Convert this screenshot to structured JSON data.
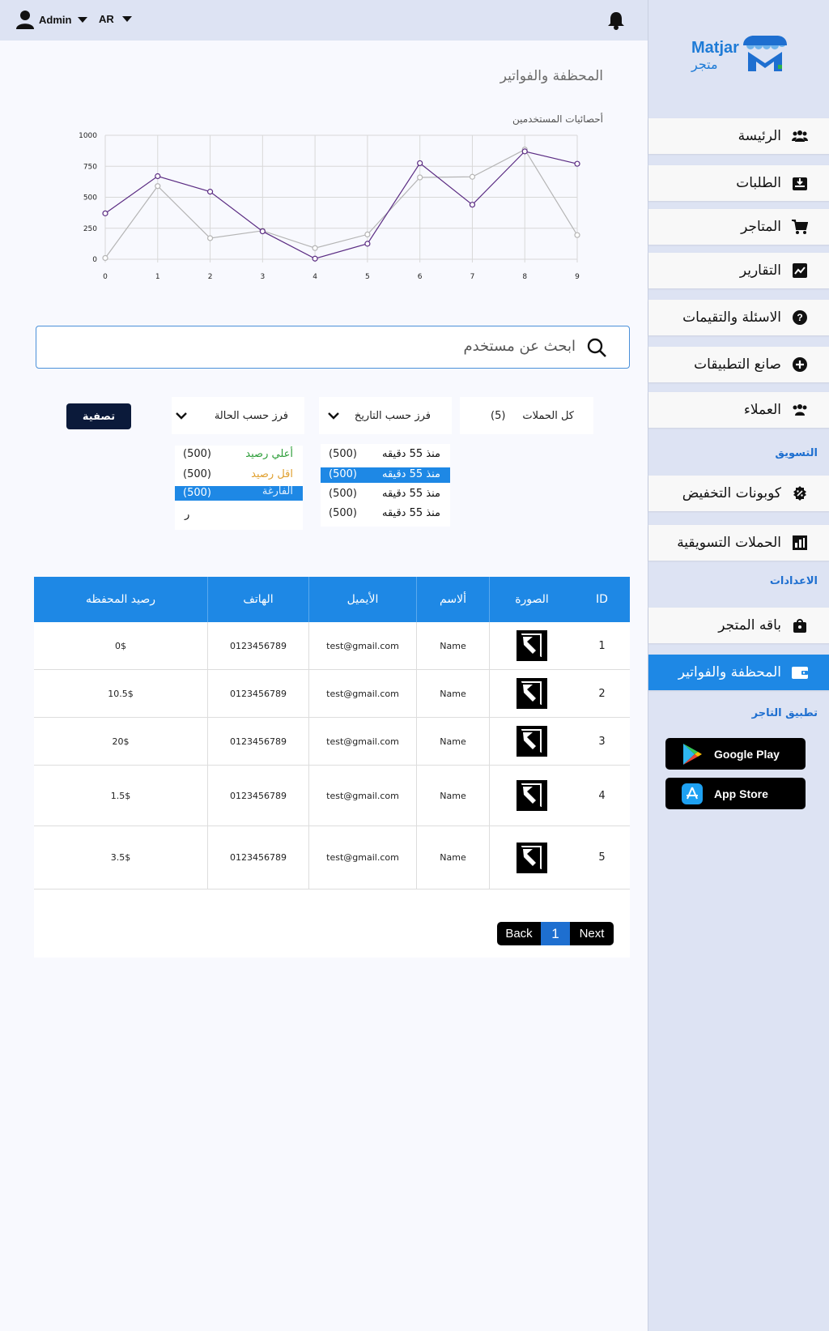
{
  "topbar": {
    "user": "Admin",
    "lang": "AR"
  },
  "logo": {
    "latin": "Matjar",
    "arabic": "متجر"
  },
  "sidebar": {
    "items": [
      {
        "label": "الرئيسة",
        "icon": "users-icon"
      },
      {
        "label": "الطلبات",
        "icon": "inbox-download-icon"
      },
      {
        "label": "المتاجر",
        "icon": "cart-icon"
      },
      {
        "label": "التقارير",
        "icon": "chart-icon"
      },
      {
        "label": "الاسئلة والتقيمات",
        "icon": "question-icon"
      },
      {
        "label": "صانع التطبيقات",
        "icon": "plus-circle-icon"
      },
      {
        "label": "العملاء",
        "icon": "users-icon"
      }
    ],
    "marketing_title": "التسويق",
    "marketing_items": [
      {
        "label": "كوبونات التخفيض",
        "icon": "discount-badge-icon"
      },
      {
        "label": "الحملات التسويقية",
        "icon": "bar-chart-icon"
      }
    ],
    "settings_title": "الاعدادات",
    "settings_items": [
      {
        "label": "باقه المتجر",
        "icon": "bag-icon"
      },
      {
        "label": "المحظفة والفواتير",
        "icon": "wallet-icon",
        "active": true
      }
    ],
    "app_title": "تطبيق التاجر",
    "stores": {
      "google": "Google Play",
      "apple": "App Store"
    }
  },
  "main": {
    "title": "المحظفة والفواتير",
    "chart_title": "أحصائيات المستخدمين",
    "search_placeholder": "ابحث عن مستخدم",
    "filters": {
      "campaigns": "كل الحملات",
      "campaigns_count": "(5)",
      "by_date": "فرز حسب  التاريخ",
      "by_status": "فرز حسب الحالة",
      "filter_button": "تصفية"
    },
    "status_options": [
      {
        "label": "أعلي رصيد",
        "count": "(500)",
        "color": "#2e9e3a"
      },
      {
        "label": "اقل رصيد",
        "count": "(500)",
        "color": "#e0a030"
      },
      {
        "label": "الفارغة",
        "count": "(500)",
        "color": "#ffffff",
        "selected": true
      }
    ],
    "status_extra": "ر",
    "date_options": [
      {
        "label": "منذ 55 دقيقه",
        "count": "(500)"
      },
      {
        "label": "منذ 55 دقيقه",
        "count": "(500)",
        "selected": true
      },
      {
        "label": "منذ 55 دقيقه",
        "count": "(500)"
      },
      {
        "label": "منذ 55 دقيقه",
        "count": "(500)"
      }
    ],
    "table": {
      "headers": [
        "ID",
        "الصورة",
        "ألاسم",
        "الأيميل",
        "الهاتف",
        "رصيد المحفظه"
      ],
      "rows": [
        {
          "id": "1",
          "name": "Name",
          "email": "test@gmail.com",
          "phone": "0123456789",
          "balance": "0$"
        },
        {
          "id": "2",
          "name": "Name",
          "email": "test@gmail.com",
          "phone": "0123456789",
          "balance": "10.5$"
        },
        {
          "id": "3",
          "name": "Name",
          "email": "test@gmail.com",
          "phone": "0123456789",
          "balance": "20$"
        },
        {
          "id": "4",
          "name": "Name",
          "email": "test@gmail.com",
          "phone": "0123456789",
          "balance": "1.5$"
        },
        {
          "id": "5",
          "name": "Name",
          "email": "test@gmail.com",
          "phone": "0123456789",
          "balance": "3.5$"
        }
      ]
    },
    "pager": {
      "back": "Back",
      "page": "1",
      "next": "Next"
    }
  },
  "chart_data": {
    "type": "line",
    "title": "أحصائيات المستخدمين",
    "x": [
      0,
      1,
      2,
      3,
      4,
      5,
      6,
      7,
      8,
      9
    ],
    "ylim": [
      0,
      1000
    ],
    "yticks": [
      0,
      250,
      500,
      750,
      1000
    ],
    "grid": true,
    "series": [
      {
        "color": "#5b2c83",
        "values": [
          370,
          670,
          545,
          225,
          5,
          125,
          775,
          440,
          870,
          770
        ]
      },
      {
        "color": "#b5b5b5",
        "values": [
          10,
          590,
          170,
          230,
          90,
          200,
          660,
          665,
          885,
          195
        ]
      }
    ]
  }
}
